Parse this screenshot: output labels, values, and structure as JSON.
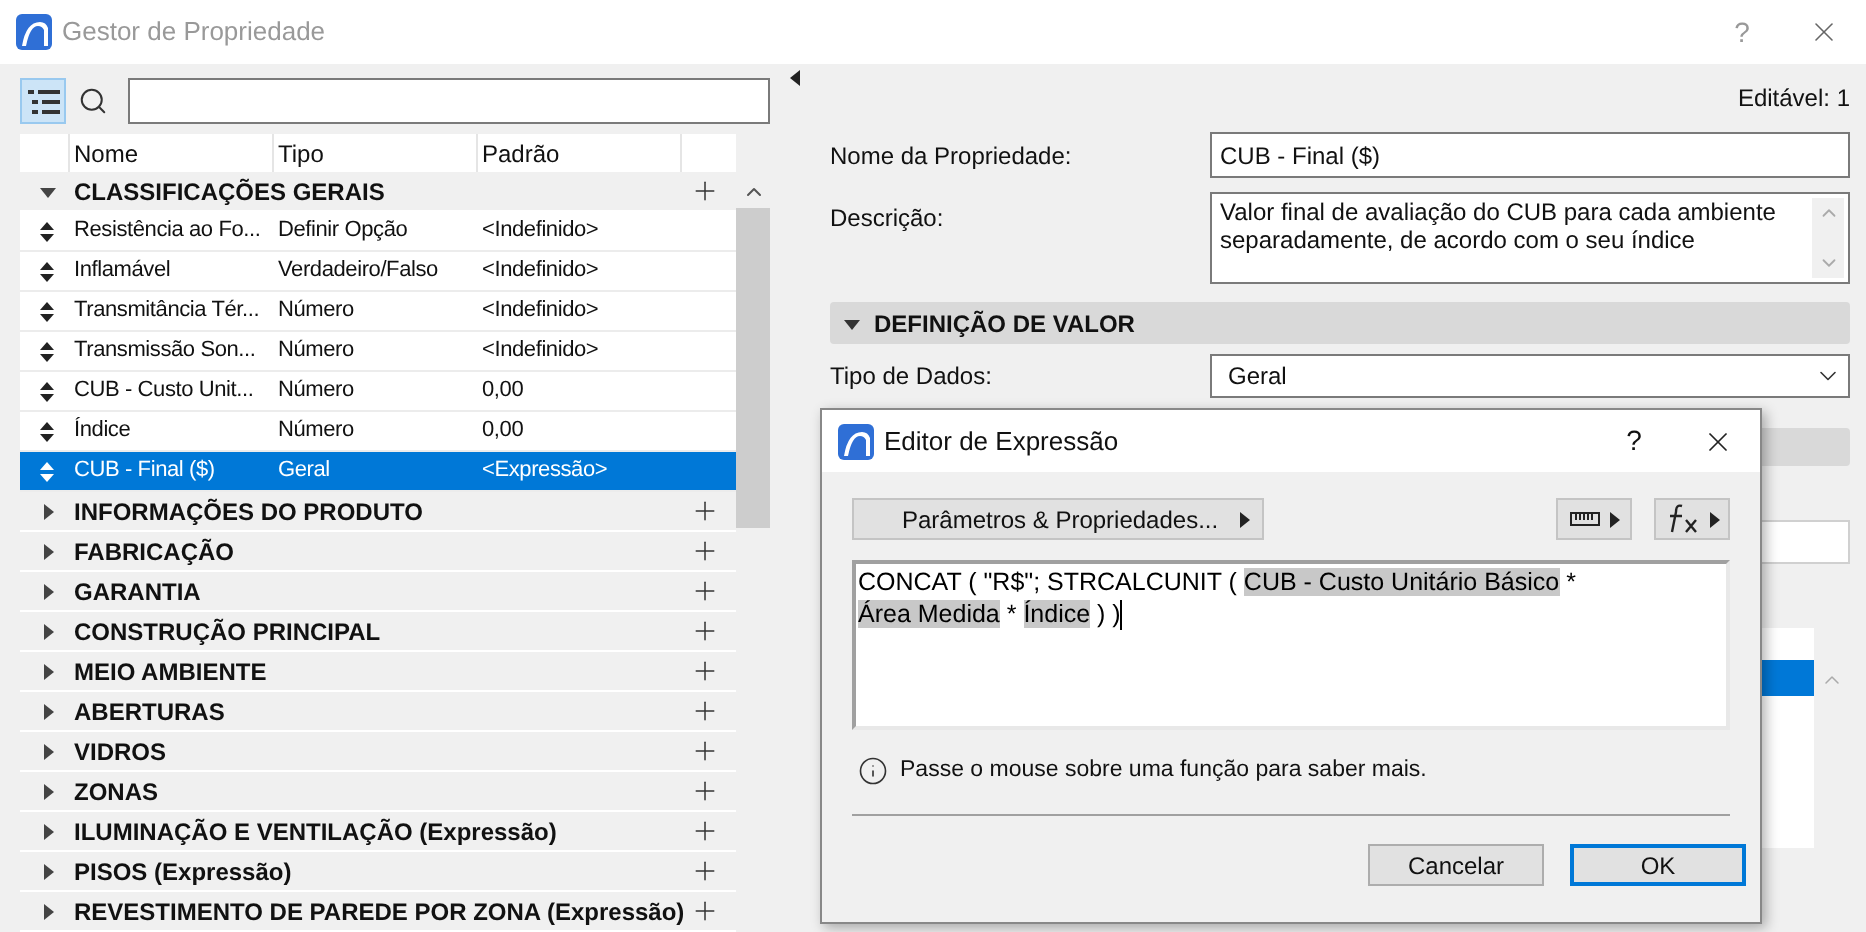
{
  "window": {
    "title": "Gestor de Propriedade",
    "help": "?"
  },
  "tree_view_button": {
    "selected": true
  },
  "table": {
    "columns": [
      "Nome",
      "Tipo",
      "Padrão"
    ],
    "groups": [
      {
        "label": "CLASSIFICAÇÕES GERAIS",
        "expanded": true,
        "children": [
          {
            "name": "Resistência ao Fo...",
            "type": "Definir Opção",
            "default": "<Indefinido>",
            "selected": false
          },
          {
            "name": "Inflamável",
            "type": "Verdadeiro/Falso",
            "default": "<Indefinido>",
            "selected": false
          },
          {
            "name": "Transmitância Tér...",
            "type": "Número",
            "default": "<Indefinido>",
            "selected": false
          },
          {
            "name": "Transmissão Son...",
            "type": "Número",
            "default": "<Indefinido>",
            "selected": false
          },
          {
            "name": "CUB - Custo Unit...",
            "type": "Número",
            "default": "0,00",
            "selected": false
          },
          {
            "name": "Índice",
            "type": "Número",
            "default": "0,00",
            "selected": false
          },
          {
            "name": "CUB - Final ($)",
            "type": "Geral",
            "default": "<Expressão>",
            "selected": true
          }
        ]
      },
      {
        "label": "INFORMAÇÕES DO PRODUTO",
        "expanded": false
      },
      {
        "label": "FABRICAÇÃO",
        "expanded": false
      },
      {
        "label": "GARANTIA",
        "expanded": false
      },
      {
        "label": "CONSTRUÇÃO PRINCIPAL",
        "expanded": false
      },
      {
        "label": "MEIO AMBIENTE",
        "expanded": false
      },
      {
        "label": "ABERTURAS",
        "expanded": false
      },
      {
        "label": "VIDROS",
        "expanded": false
      },
      {
        "label": "ZONAS",
        "expanded": false
      },
      {
        "label": "ILUMINAÇÃO E VENTILAÇÃO (Expressão)",
        "expanded": false
      },
      {
        "label": "PISOS (Expressão)",
        "expanded": false
      },
      {
        "label": "REVESTIMENTO DE PAREDE POR ZONA (Expressão)",
        "expanded": false
      }
    ]
  },
  "editable": "Editável: 1",
  "form": {
    "name_label": "Nome da Propriedade:",
    "name_value": "CUB - Final ($)",
    "description_label": "Descrição:",
    "description_value": "Valor final de avaliação do CUB para cada ambiente separadamente, de acordo com o seu índice"
  },
  "value_section": {
    "title": "DEFINIÇÃO DE VALOR",
    "expanded": true,
    "data_type_label": "Tipo de Dados:",
    "data_type_value": "Geral"
  },
  "dialog": {
    "title": "Editor de Expressão",
    "help": "?",
    "params_button": "Parâmetros & Propriedades...",
    "expression": [
      {
        "kind": "text",
        "text": "CONCAT ( \"R$\"; STRCALCUNIT ( "
      },
      {
        "kind": "token",
        "text": "CUB - Custo Unitário Básico"
      },
      {
        "kind": "text",
        "text": " * "
      },
      {
        "kind": "token",
        "text": "Área Medida"
      },
      {
        "kind": "text",
        "text": " * "
      },
      {
        "kind": "token",
        "text": "Índice"
      },
      {
        "kind": "text",
        "text": " ) )"
      }
    ],
    "hint": "Passe o mouse sobre uma função para saber mais.",
    "buttons": [
      {
        "label": "Cancelar",
        "default": false
      },
      {
        "label": "OK",
        "default": true
      }
    ]
  }
}
